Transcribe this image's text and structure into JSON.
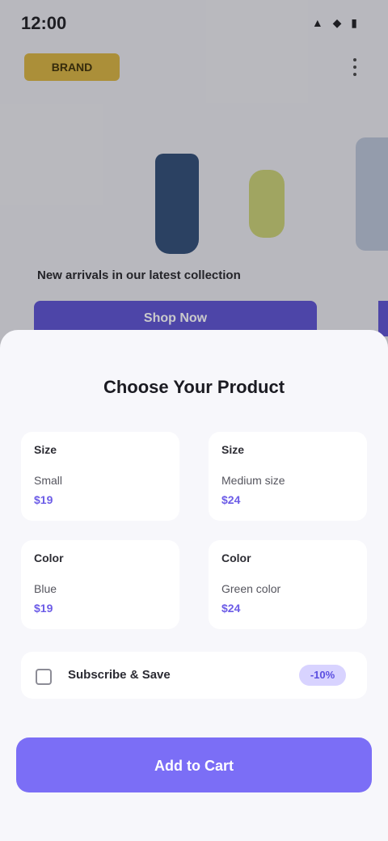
{
  "status_bar": {
    "time": "12:00",
    "icons": "▲ ◆ ▮"
  },
  "background": {
    "brand_badge": "BRAND",
    "promo_text": "New arrivals in our latest collection",
    "promo_button": "Shop Now"
  },
  "sheet": {
    "title": "Choose Your Product",
    "options": [
      {
        "label": "Size",
        "value": "Small",
        "price": "$19"
      },
      {
        "label": "Size",
        "value": "Medium size",
        "price": "$24"
      },
      {
        "label": "Color",
        "value": "Blue",
        "price": "$19"
      },
      {
        "label": "Color",
        "value": "Green color",
        "price": "$24"
      }
    ],
    "subscribe_label": "Subscribe & Save",
    "subscribe_pill": "-10%",
    "cta_label": "Add to Cart"
  },
  "colors": {
    "accent": "#7b6ef6",
    "brand_gold": "#d7b23c"
  }
}
